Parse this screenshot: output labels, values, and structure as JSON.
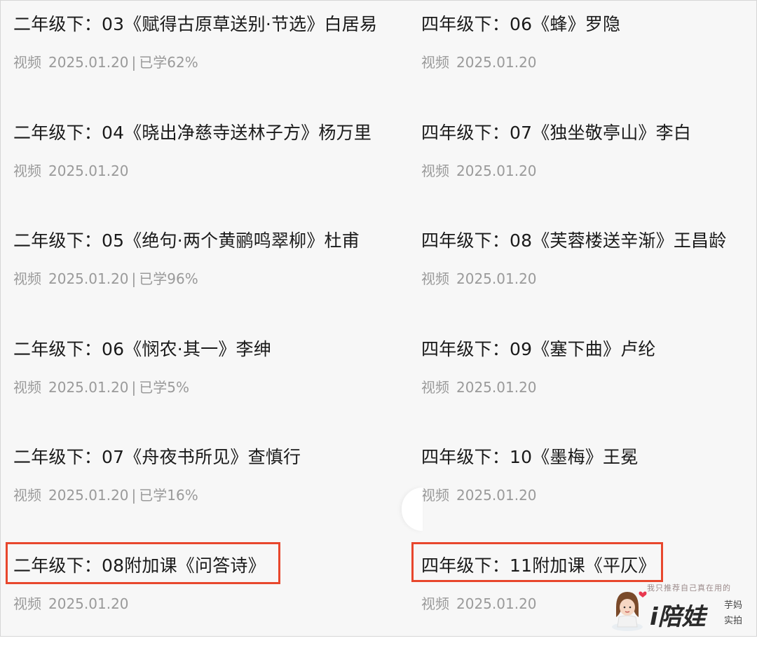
{
  "left_column": [
    {
      "title": "二年级下：03《赋得古原草送别·节选》白居易",
      "type": "视频",
      "date": "2025.01.20",
      "progress": "已学62%"
    },
    {
      "title": "二年级下：04《晓出净慈寺送林子方》杨万里",
      "type": "视频",
      "date": "2025.01.20",
      "progress": ""
    },
    {
      "title": "二年级下：05《绝句·两个黄鹂鸣翠柳》杜甫",
      "type": "视频",
      "date": "2025.01.20",
      "progress": "已学96%"
    },
    {
      "title": "二年级下：06《悯农·其一》李绅",
      "type": "视频",
      "date": "2025.01.20",
      "progress": "已学5%"
    },
    {
      "title": "二年级下：07《舟夜书所见》查慎行",
      "type": "视频",
      "date": "2025.01.20",
      "progress": "已学16%"
    },
    {
      "title": "二年级下：08附加课《问答诗》",
      "type": "视频",
      "date": "2025.01.20",
      "progress": ""
    }
  ],
  "right_column": [
    {
      "title": "四年级下：06《蜂》罗隐",
      "type": "视频",
      "date": "2025.01.20",
      "progress": ""
    },
    {
      "title": "四年级下：07《独坐敬亭山》李白",
      "type": "视频",
      "date": "2025.01.20",
      "progress": ""
    },
    {
      "title": "四年级下：08《芙蓉楼送辛渐》王昌龄",
      "type": "视频",
      "date": "2025.01.20",
      "progress": ""
    },
    {
      "title": "四年级下：09《塞下曲》卢纶",
      "type": "视频",
      "date": "2025.01.20",
      "progress": ""
    },
    {
      "title": "四年级下：10《墨梅》王冕",
      "type": "视频",
      "date": "2025.01.20",
      "progress": ""
    },
    {
      "title": "四年级下：11附加课《平仄》",
      "type": "视频",
      "date": "2025.01.20",
      "progress": ""
    }
  ],
  "separator": "|",
  "watermark": {
    "slogan": "我只推荐自己真在用的",
    "brand": "i陪娃",
    "tag1": "芋妈",
    "tag2": "实拍"
  },
  "colors": {
    "highlight": "#e8472d",
    "title": "#1a1a1a",
    "meta": "#9a9a9a",
    "background": "#f7f7f7"
  }
}
